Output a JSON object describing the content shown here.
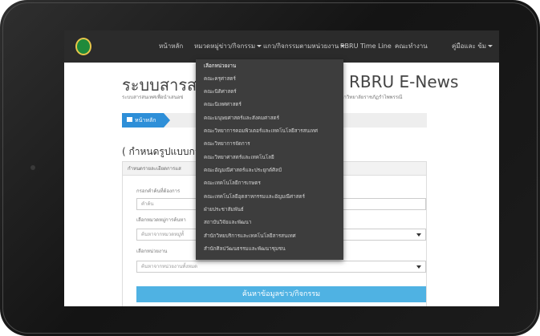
{
  "nav": {
    "home": "หน้าหลัก",
    "news_category": "หมวดหมู่ข่าว/กิจกรรม",
    "unit_activities": "แกว/กิจกรรมตามหน่วยงาน",
    "timeline": "RBRU Time Line",
    "faculty_menu": "คณะทำงาน",
    "manual": "คู่มือและ ข้ม"
  },
  "header": {
    "title_left": "ระบบสารสนเท",
    "title_right": "RBRU E-News",
    "subtitle_left": "ระบบสารสนเทศเพื่อนำเสนอข่",
    "subtitle_right": "ของมหาวิทยาลัยราชภัฏรำไพพรรณี"
  },
  "breadcrumb": {
    "home": "หน้าหลัก"
  },
  "section": {
    "title": "( กำหนดรูปแบบการแ"
  },
  "panel": {
    "header": "กำหนดรายละเอียดการแส",
    "keyword_label": "กรอกคำค้นที่ต้องการ",
    "keyword_placeholder": "คำค้น",
    "category_label": "เลือกหมวดหมู่การค้นหา",
    "category_value": "ค้นหาจากหมวดหมู่ทั้",
    "unit_label": "เลือกหน่วยงาน",
    "unit_value": "ค้นหาจากหน่วยงานทั้งหมด",
    "search_button": "ค้นหาข้อมูลข่าว/กิจกรรม"
  },
  "dropdown": {
    "items": [
      "เลือกหน่วยงาน",
      "คณะครุศาสตร์",
      "คณะนิติศาสตร์",
      "คณะนิเทศศาสตร์",
      "คณะมนุษยศาสตร์และสังคมศาสตร์",
      "คณะวิทยาการคอมพิวเตอร์และเทคโนโลยีสารสนเทศ",
      "คณะวิทยาการจัดการ",
      "คณะวิทยาศาสตร์และเทคโนโลยี",
      "คณะอัญมณีศาสตร์และประยุกต์ศิลป์",
      "คณะเทคโนโลยีการเกษตร",
      "คณะเทคโนโลยีอุตสาหกรรมและอัญมณีศาสตร์",
      "ฝ่ายประชาสัมพันธ์",
      "สถาบันวิจัยและพัฒนา",
      "สำนักวิทยบริการและเทคโนโลยีสารสนเทศ",
      "สำนักศิลปวัฒนธรรมและพัฒนาชุมชน"
    ]
  }
}
